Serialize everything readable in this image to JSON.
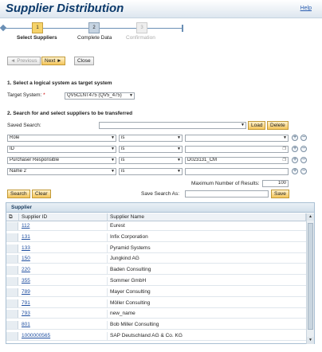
{
  "header": {
    "title": "Supplier Distribution",
    "help": "Help"
  },
  "roadmap": {
    "steps": [
      {
        "num": "1",
        "label": "Select Suppliers",
        "state": "active"
      },
      {
        "num": "2",
        "label": "Complete Data",
        "state": "normal"
      },
      {
        "num": "3",
        "label": "Confirmation",
        "state": "disabled"
      }
    ]
  },
  "nav": {
    "previous": "◄ Previous",
    "next": "Next ►",
    "close": "Close"
  },
  "section1": {
    "title": "1. Select a logical system as target system",
    "target_label": "Target System:",
    "required": "*",
    "target_value": "QV5CLNT475 (QV5_475)"
  },
  "section2": {
    "title": "2. Search for and select suppliers to be transferred",
    "saved_search_label": "Saved Search:",
    "saved_search_value": "",
    "load": "Load",
    "delete": "Delete",
    "criteria": [
      {
        "field": "Role",
        "op": "is",
        "value": ""
      },
      {
        "field": "ID",
        "op": "is",
        "value": ""
      },
      {
        "field": "Purchaser Responsible",
        "op": "is",
        "value": "D023131_CM"
      },
      {
        "field": "Name 2",
        "op": "is",
        "value": ""
      }
    ],
    "max_results_label": "Maximum Number of Results:",
    "max_results_value": "100",
    "search": "Search",
    "clear": "Clear",
    "save_search_as_label": "Save Search As:",
    "save_search_as_value": "",
    "save": "Save"
  },
  "table": {
    "title": "Supplier",
    "col_id": "Supplier ID",
    "col_name": "Supplier Name",
    "rows": [
      {
        "id": "112",
        "name": "Eurest"
      },
      {
        "id": "131",
        "name": "Infix Corporation"
      },
      {
        "id": "133",
        "name": "Pyramid Systems"
      },
      {
        "id": "150",
        "name": "Jungkind AG"
      },
      {
        "id": "220",
        "name": "Baden Consulting"
      },
      {
        "id": "355",
        "name": "Sommer GmbH"
      },
      {
        "id": "789",
        "name": "Mayer Consulting"
      },
      {
        "id": "791",
        "name": "Möller Consulting"
      },
      {
        "id": "793",
        "name": "new_name"
      },
      {
        "id": "801",
        "name": "Bob Miller Consulting"
      },
      {
        "id": "1000000565",
        "name": "SAP Deutschland AG & Co. KG"
      }
    ]
  },
  "colors": {
    "title": "#0c3a6b",
    "accent": "#f4c55a",
    "link": "#1f4fa0"
  },
  "icons": {
    "add": "plus-circle-icon",
    "remove": "minus-circle-icon",
    "valuehelp": "value-help-icon",
    "dropdown": "chevron-down-icon"
  }
}
